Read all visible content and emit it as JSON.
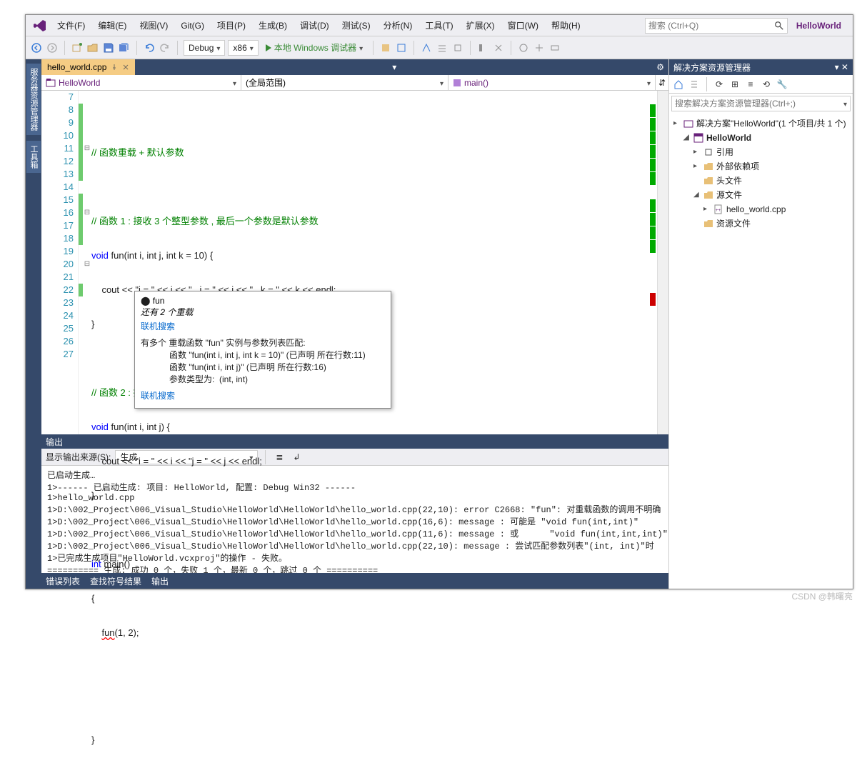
{
  "menu": {
    "file": "文件(F)",
    "edit": "编辑(E)",
    "view": "视图(V)",
    "git": "Git(G)",
    "project": "项目(P)",
    "build": "生成(B)",
    "debug": "调试(D)",
    "test": "测试(S)",
    "analyze": "分析(N)",
    "tools": "工具(T)",
    "extensions": "扩展(X)",
    "window": "窗口(W)",
    "help": "帮助(H)"
  },
  "search": {
    "placeholder": "搜索 (Ctrl+Q)"
  },
  "project_name": "HelloWorld",
  "toolbar": {
    "config": "Debug",
    "platform": "x86",
    "start_debug": "本地 Windows 调试器"
  },
  "left_tabs": {
    "server": "服务器资源管理器",
    "toolbox": "工具箱"
  },
  "tab": {
    "filename": "hello_world.cpp"
  },
  "nav": {
    "project": "HelloWorld",
    "scope": "(全局范围)",
    "member": "main()"
  },
  "code": {
    "lines": [
      7,
      8,
      9,
      10,
      11,
      12,
      13,
      14,
      15,
      16,
      17,
      18,
      19,
      20,
      21,
      22,
      23,
      24,
      25,
      26,
      27
    ],
    "l8_comment": "// 函数重载 + 默认参数",
    "l10_comment": "// 函数 1 : 接收 3 个整型参数 , 最后一个参数是默认参数",
    "l11_sig_pre": "void",
    "l11_fun": "fun",
    "l11_params": "(int i, int j, int k = 10) {",
    "l12_body": "    cout << \"i = \" << i << \" , j = \" << j << \" , k = \" << k << endl;",
    "l13": "}",
    "l15_comment": "// 函数 2 : 接收 2 个整型参数",
    "l16_sig_pre": "void",
    "l16_fun": "fun",
    "l16_params": "(int i, int j) {",
    "l17_body": "    cout << \"i = \" << i << \"j = \" << j << endl;",
    "l18": "}",
    "l20": "int main()",
    "l21": "{",
    "l22_call": "    fun(1, 2);",
    "l27": "}"
  },
  "intellisense": {
    "icon": "⚫",
    "title": "fun",
    "more": "还有 2 个重载",
    "search1": "联机搜索",
    "body": "有多个 重载函数 \"fun\" 实例与参数列表匹配:\n            函数 \"fun(int i, int j, int k = 10)\" (已声明 所在行数:11)\n            函数 \"fun(int i, int j)\" (已声明 所在行数:16)\n            参数类型为:  (int, int)",
    "search2": "联机搜索"
  },
  "output": {
    "title": "输出",
    "source_label": "显示输出来源(S):",
    "source_value": "生成",
    "lines": [
      "已启动生成…",
      "1>------ 已启动生成: 项目: HelloWorld, 配置: Debug Win32 ------",
      "1>hello_world.cpp",
      "1>D:\\002_Project\\006_Visual_Studio\\HelloWorld\\HelloWorld\\hello_world.cpp(22,10): error C2668: \"fun\": 对重载函数的调用不明确",
      "1>D:\\002_Project\\006_Visual_Studio\\HelloWorld\\HelloWorld\\hello_world.cpp(16,6): message : 可能是 \"void fun(int,int)\"",
      "1>D:\\002_Project\\006_Visual_Studio\\HelloWorld\\HelloWorld\\hello_world.cpp(11,6): message : 或      \"void fun(int,int,int)\"",
      "1>D:\\002_Project\\006_Visual_Studio\\HelloWorld\\HelloWorld\\hello_world.cpp(22,10): message : 尝试匹配参数列表\"(int, int)\"时",
      "1>已完成生成项目\"HelloWorld.vcxproj\"的操作 - 失败。",
      "========== 生成: 成功 0 个，失败 1 个，最新 0 个，跳过 0 个 =========="
    ]
  },
  "bottom_tabs": [
    "错误列表",
    "查找符号结果",
    "输出"
  ],
  "solution": {
    "title": "解决方案资源管理器",
    "search_placeholder": "搜索解决方案资源管理器(Ctrl+;)",
    "root": "解决方案\"HelloWorld\"(1 个项目/共 1 个)",
    "project": "HelloWorld",
    "references": "引用",
    "external": "外部依赖项",
    "headers": "头文件",
    "sources": "源文件",
    "source_file": "hello_world.cpp",
    "resources": "资源文件"
  },
  "watermark": "CSDN @韩曙亮"
}
